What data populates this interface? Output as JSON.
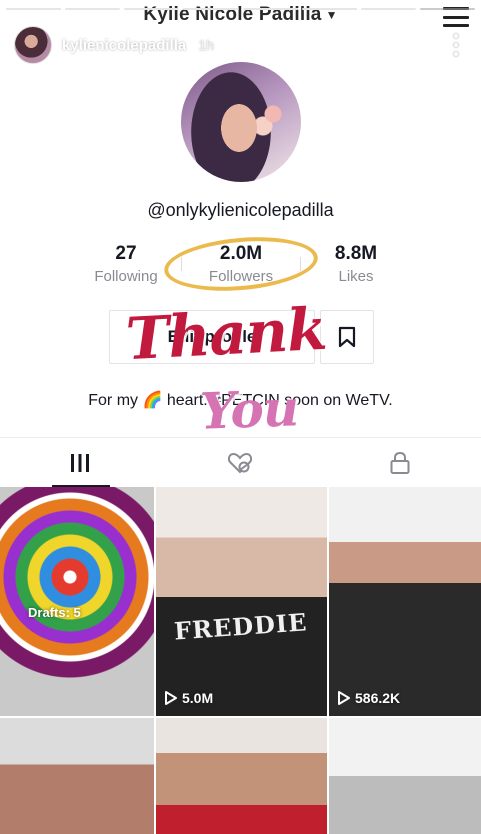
{
  "header": {
    "title": "Kylie Nicole Padilla"
  },
  "story": {
    "username": "kylienicolepadilla",
    "time": "1h",
    "bar_count": 8,
    "bars_done": 7
  },
  "profile": {
    "handle": "@onlykylienicolepadilla",
    "stats": [
      {
        "value": "27",
        "label": "Following"
      },
      {
        "value": "2.0M",
        "label": "Followers"
      },
      {
        "value": "8.8M",
        "label": "Likes"
      }
    ],
    "edit_label": "Edit profile",
    "bio": "For my 🌈 heart. #PETCIN soon on WeTV."
  },
  "sticker": {
    "line1": "Thank",
    "line2": "You"
  },
  "grid": {
    "drafts_label": "Drafts: 5",
    "shirt_text": "FREDDIE",
    "views": [
      "5.0M",
      "586.2K"
    ]
  },
  "colors": {
    "circle_annotation": "#e9b23a",
    "thank": "#c2193f",
    "you": "#d573b3"
  }
}
